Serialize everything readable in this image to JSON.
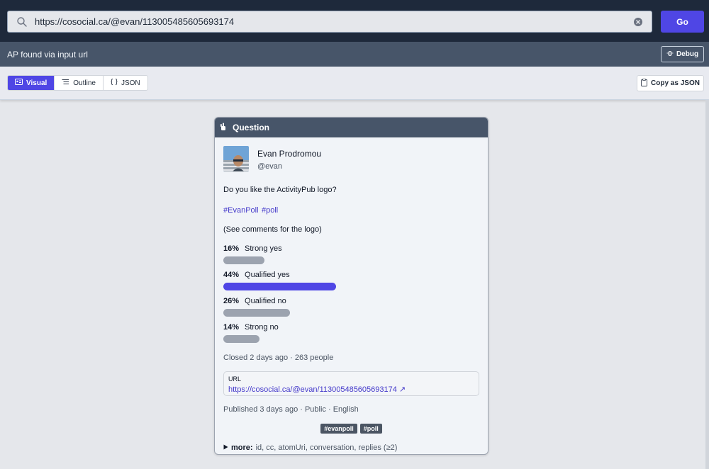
{
  "search": {
    "value": "https://cosocial.ca/@evan/113005485605693174",
    "go_label": "Go"
  },
  "status": {
    "text": "AP found via input url",
    "debug_label": "Debug"
  },
  "toolbar": {
    "tabs": [
      {
        "label": "Visual",
        "active": true
      },
      {
        "label": "Outline",
        "active": false
      },
      {
        "label": "JSON",
        "active": false
      }
    ],
    "copy_label": "Copy as JSON"
  },
  "card": {
    "type_label": "Question",
    "author": {
      "name": "Evan Prodromou",
      "handle": "@evan"
    },
    "content": {
      "question": "Do you like the ActivityPub logo?",
      "hashtags": [
        "#EvanPoll",
        "#poll"
      ],
      "note": "(See comments for the logo)"
    },
    "poll": {
      "options": [
        {
          "percent": "16%",
          "label": "Strong yes",
          "fraction": 0.16,
          "leading": false
        },
        {
          "percent": "44%",
          "label": "Qualified yes",
          "fraction": 0.44,
          "leading": true
        },
        {
          "percent": "26%",
          "label": "Qualified no",
          "fraction": 0.26,
          "leading": false
        },
        {
          "percent": "14%",
          "label": "Strong no",
          "fraction": 0.14,
          "leading": false
        }
      ],
      "closed_text": "Closed 2 days ago · 263 people"
    },
    "url": {
      "label": "URL",
      "link": "https://cosocial.ca/@evan/113005485605693174 ↗"
    },
    "meta": "Published 3 days ago · Public · English",
    "tags": [
      "#evanpoll",
      "#poll"
    ],
    "more": {
      "label": "more:",
      "fields": "id, cc, atomUri, conversation, replies (≥2)"
    }
  },
  "colors": {
    "accent": "#4f46e5",
    "topbar": "#1e293b",
    "statusbar": "#475569",
    "bar_default": "#9ca3af"
  }
}
